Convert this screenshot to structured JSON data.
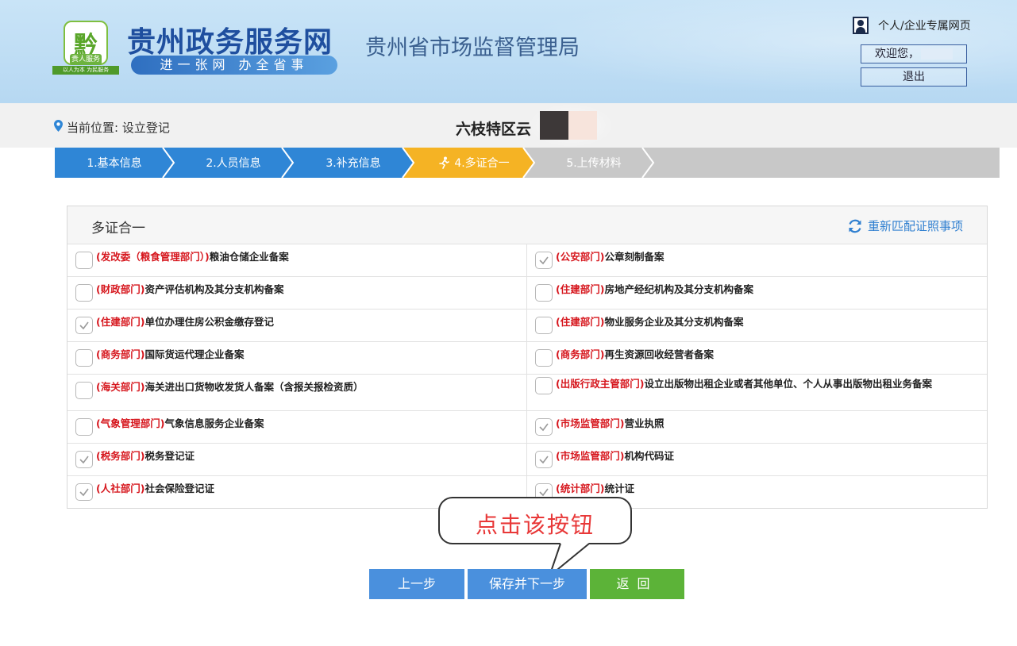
{
  "header": {
    "logo_glyph": "黔",
    "logo_tag": "贵人服务",
    "logo_slogan": "以人为本 为民服务",
    "site_title": "贵州政务服务网",
    "site_slogan": "进一张网 办全省事",
    "bureau": "贵州省市场监督管理局",
    "user_link": "个人/企业专属网页",
    "welcome": "欢迎您，",
    "logout": "退出"
  },
  "location": {
    "text": "当前位置: 设立登记",
    "company": "六枝特区云"
  },
  "steps": [
    {
      "label": "1.基本信息",
      "state": "done"
    },
    {
      "label": "2.人员信息",
      "state": "done"
    },
    {
      "label": "3.补充信息",
      "state": "done"
    },
    {
      "label": "4.多证合一",
      "state": "current"
    },
    {
      "label": "5.上传材料",
      "state": "pending"
    }
  ],
  "panel": {
    "title": "多证合一",
    "rematch": "重新匹配证照事项",
    "rows": [
      [
        {
          "dept": "(发改委（粮食管理部门）)",
          "name": "粮油仓储企业备案",
          "checked": false
        },
        {
          "dept": "(公安部门)",
          "name": "公章刻制备案",
          "checked": true
        }
      ],
      [
        {
          "dept": "(财政部门)",
          "name": "资产评估机构及其分支机构备案",
          "checked": false
        },
        {
          "dept": "(住建部门)",
          "name": "房地产经纪机构及其分支机构备案",
          "checked": false
        }
      ],
      [
        {
          "dept": "(住建部门)",
          "name": "单位办理住房公积金缴存登记",
          "checked": true
        },
        {
          "dept": "(住建部门)",
          "name": "物业服务企业及其分支机构备案",
          "checked": false
        }
      ],
      [
        {
          "dept": "(商务部门)",
          "name": "国际货运代理企业备案",
          "checked": false
        },
        {
          "dept": "(商务部门)",
          "name": "再生资源回收经营者备案",
          "checked": false
        }
      ],
      [
        {
          "dept": "(海关部门)",
          "name": "海关进出口货物收发货人备案（含报关报检资质）",
          "checked": false
        },
        {
          "dept": "(出版行政主管部门)",
          "name": "设立出版物出租企业或者其他单位、个人从事出版物出租业务备案",
          "checked": false
        }
      ],
      [
        {
          "dept": "(气象管理部门)",
          "name": "气象信息服务企业备案",
          "checked": false
        },
        {
          "dept": "(市场监管部门)",
          "name": "营业执照",
          "checked": true
        }
      ],
      [
        {
          "dept": "(税务部门)",
          "name": "税务登记证",
          "checked": true
        },
        {
          "dept": "(市场监管部门)",
          "name": "机构代码证",
          "checked": true
        }
      ],
      [
        {
          "dept": "(人社部门)",
          "name": "社会保险登记证",
          "checked": true
        },
        {
          "dept": "(统计部门)",
          "name": "统计证",
          "checked": true
        }
      ]
    ]
  },
  "callout": "点击该按钮",
  "buttons": {
    "prev": "上一步",
    "save": "保存并下一步",
    "back": "返回"
  },
  "colors": {
    "step_done": "#2f86d6",
    "step_current": "#f5b324",
    "step_pending": "#c8c8c8",
    "dept_red": "#d6161d",
    "btn_blue": "#4a90dd",
    "btn_green": "#5cb338"
  }
}
